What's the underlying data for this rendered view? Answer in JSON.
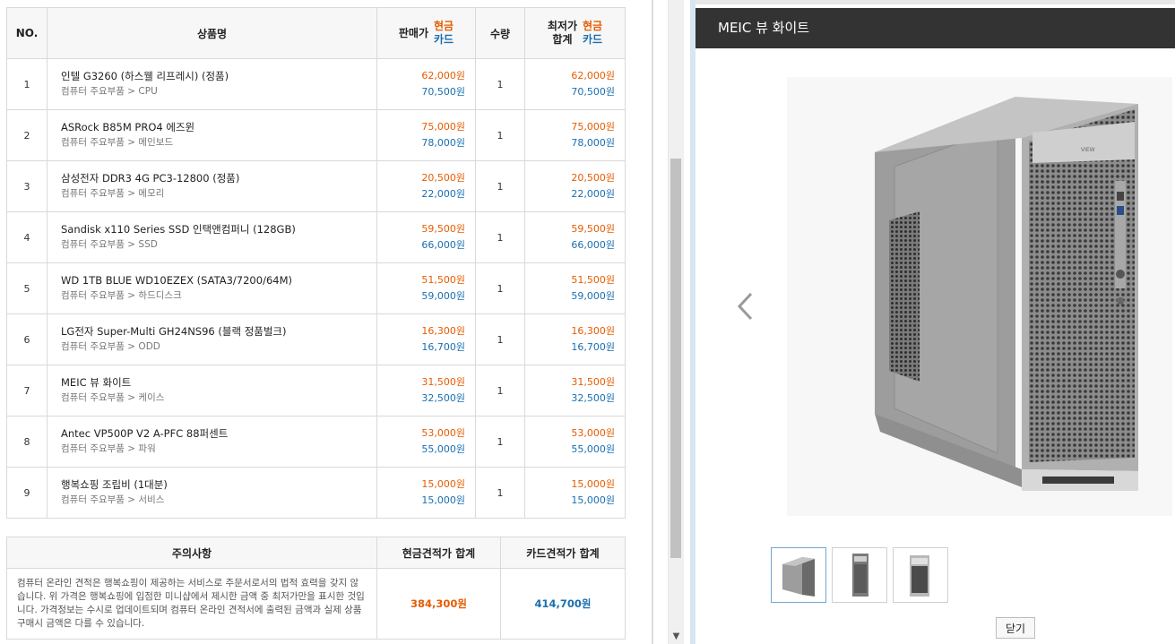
{
  "table": {
    "headers": {
      "no": "NO.",
      "name": "상품명",
      "price": "판매가",
      "cash": "현금",
      "card": "카드",
      "qty": "수량",
      "total_line1": "최저가",
      "total_line2": "합계"
    },
    "rows": [
      {
        "no": "1",
        "name": "인텔 G3260 (하스웰 리프레시) (정품)",
        "category": "컴퓨터 주요부품 > CPU",
        "cash": "62,000원",
        "card": "70,500원",
        "qty": "1",
        "total_cash": "62,000원",
        "total_card": "70,500원"
      },
      {
        "no": "2",
        "name": "ASRock B85M PRO4 에즈윈",
        "category": "컴퓨터 주요부품 > 메인보드",
        "cash": "75,000원",
        "card": "78,000원",
        "qty": "1",
        "total_cash": "75,000원",
        "total_card": "78,000원"
      },
      {
        "no": "3",
        "name": "삼성전자 DDR3 4G PC3-12800 (정품)",
        "category": "컴퓨터 주요부품 > 메모리",
        "cash": "20,500원",
        "card": "22,000원",
        "qty": "1",
        "total_cash": "20,500원",
        "total_card": "22,000원"
      },
      {
        "no": "4",
        "name": "Sandisk x110 Series SSD 인택앤컴퍼니 (128GB)",
        "category": "컴퓨터 주요부품 > SSD",
        "cash": "59,500원",
        "card": "66,000원",
        "qty": "1",
        "total_cash": "59,500원",
        "total_card": "66,000원"
      },
      {
        "no": "5",
        "name": "WD 1TB BLUE WD10EZEX (SATA3/7200/64M)",
        "category": "컴퓨터 주요부품 > 하드디스크",
        "cash": "51,500원",
        "card": "59,000원",
        "qty": "1",
        "total_cash": "51,500원",
        "total_card": "59,000원"
      },
      {
        "no": "6",
        "name": "LG전자 Super-Multi GH24NS96 (블랙 정품벌크)",
        "category": "컴퓨터 주요부품 > ODD",
        "cash": "16,300원",
        "card": "16,700원",
        "qty": "1",
        "total_cash": "16,300원",
        "total_card": "16,700원"
      },
      {
        "no": "7",
        "name": "MEIC 뷰 화이트",
        "category": "컴퓨터 주요부품 > 케이스",
        "cash": "31,500원",
        "card": "32,500원",
        "qty": "1",
        "total_cash": "31,500원",
        "total_card": "32,500원"
      },
      {
        "no": "8",
        "name": "Antec VP500P V2 A-PFC 88퍼센트",
        "category": "컴퓨터 주요부품 > 파워",
        "cash": "53,000원",
        "card": "55,000원",
        "qty": "1",
        "total_cash": "53,000원",
        "total_card": "55,000원"
      },
      {
        "no": "9",
        "name": "행복쇼핑 조립비 (1대분)",
        "category": "컴퓨터 주요부품 > 서비스",
        "cash": "15,000원",
        "card": "15,000원",
        "qty": "1",
        "total_cash": "15,000원",
        "total_card": "15,000원"
      }
    ]
  },
  "summary": {
    "notice_header": "주의사항",
    "cash_total_header": "현금견적가 합계",
    "card_total_header": "카드견적가 합계",
    "notice_text": "컴퓨터 온라인 견적은 행복쇼핑이 제공하는 서비스로 주문서로서의 법적 효력을 갖지 않습니다. 위 가격은 행복쇼핑에 입점한 미니샵에서 제시한 금액 중 최저가만을 표시한 것입니다. 가격정보는 수시로 업데이트되며 컴퓨터 온라인 견적서에 출력된 금액과 실제 상품 구매시 금액은 다를 수 있습니다.",
    "cash_total": "384,300원",
    "card_total": "414,700원"
  },
  "popup": {
    "title": "MEIC 뷰 화이트",
    "case_badge": "VIEW",
    "close_label": "닫기",
    "thumbnail_count": 3,
    "active_thumbnail": 1
  },
  "colors": {
    "cash": "#e65c00",
    "card": "#1a6fb0",
    "header_bar": "#333333"
  },
  "icons": [
    "chevron-left-icon",
    "chevron-down-icon"
  ]
}
